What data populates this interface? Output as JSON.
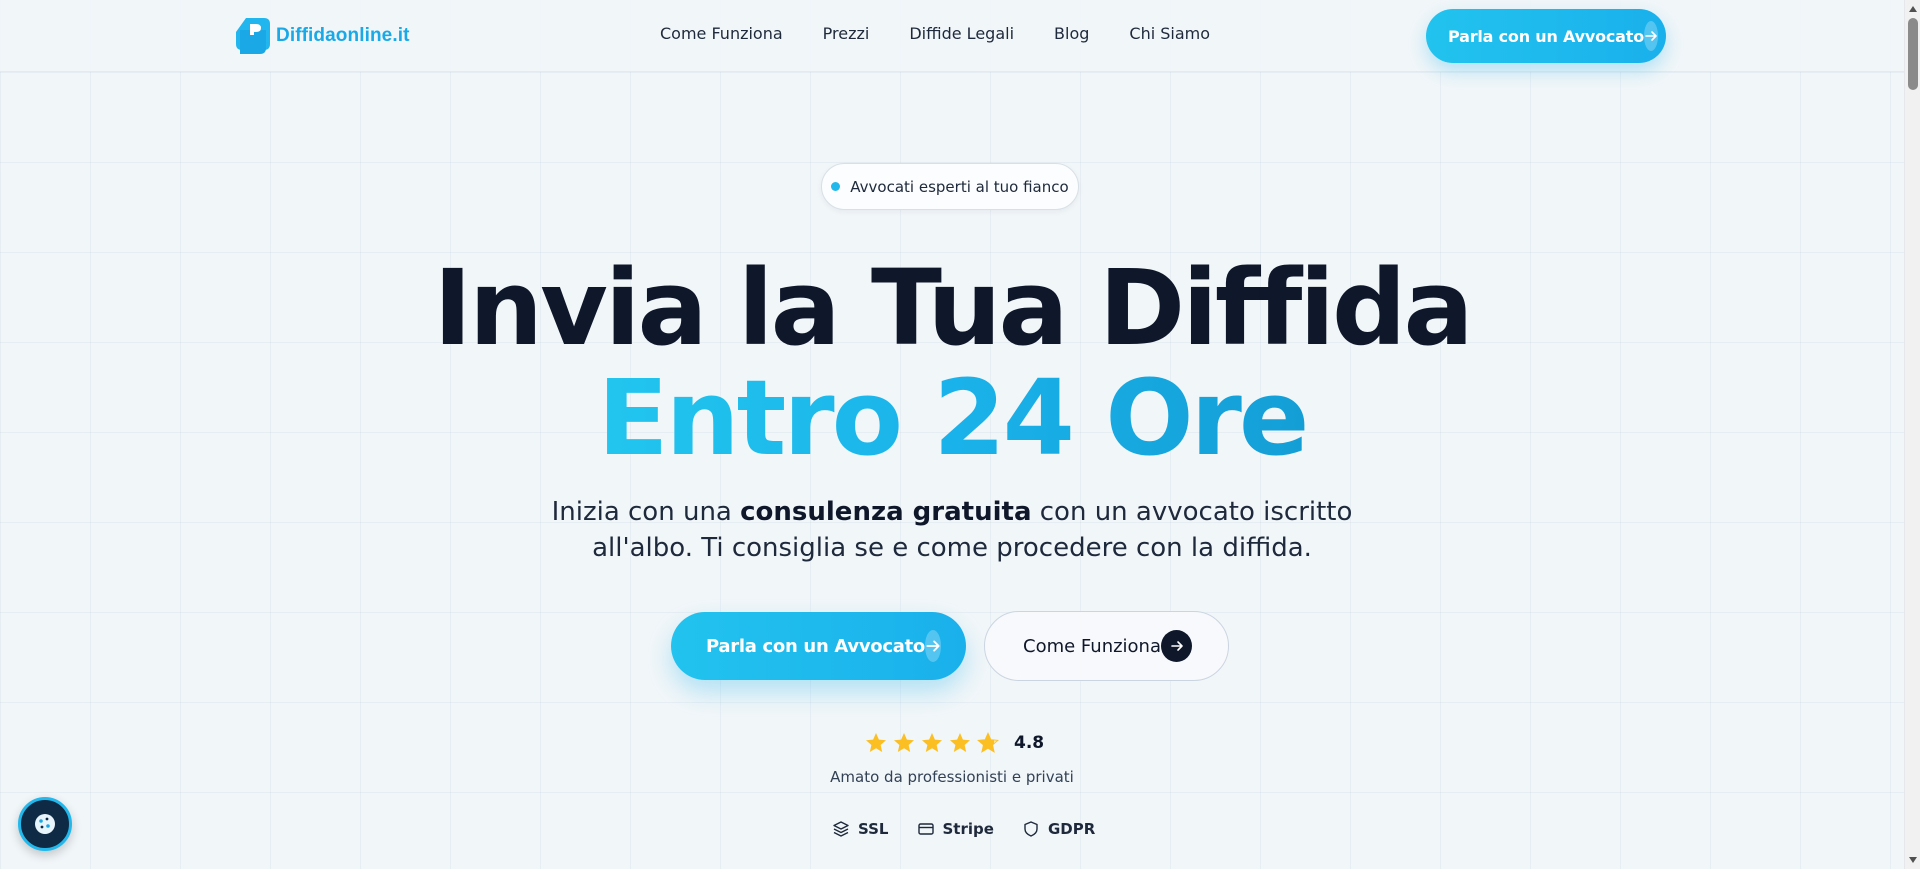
{
  "brand": {
    "name": "Diffidaonline.it",
    "accent": "#1aa9e6"
  },
  "nav": {
    "links": [
      "Come Funziona",
      "Prezzi",
      "Diffide Legali",
      "Blog",
      "Chi Siamo"
    ],
    "cta_label": "Parla con un Avvocato"
  },
  "hero": {
    "badge": "Avvocati esperti al tuo fianco",
    "title_line1": "Invia la Tua Diffida",
    "title_line2": "Entro 24 Ore",
    "subtitle_pre": "Inizia con una ",
    "subtitle_bold": "consulenza gratuita",
    "subtitle_post": " con un avvocato iscritto",
    "subtitle_line2": "all'albo. Ti consiglia se e come procedere con la diffida.",
    "primary_cta": "Parla con un Avvocato",
    "secondary_cta": "Come Funziona",
    "rating_value": "4.8",
    "rating_stars": 4.8,
    "rating_caption": "Amato da professionisti e privati",
    "trust": [
      {
        "icon": "layers-icon",
        "label": "SSL"
      },
      {
        "icon": "card-icon",
        "label": "Stripe"
      },
      {
        "icon": "shield-icon",
        "label": "GDPR"
      }
    ]
  },
  "colors": {
    "primary": "#22c3ee",
    "dark": "#0f172a",
    "star": "#fbbf24"
  }
}
